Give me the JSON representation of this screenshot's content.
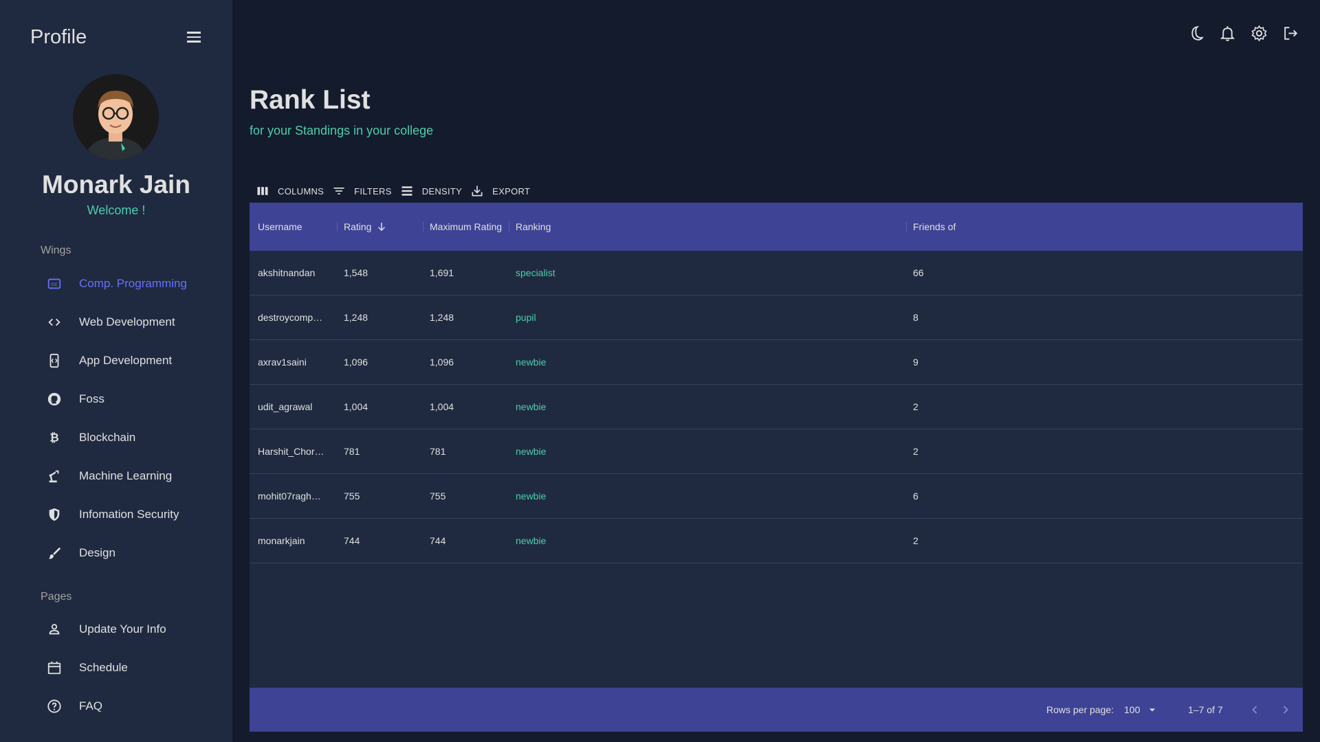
{
  "sidebar": {
    "title": "Profile",
    "user": {
      "name": "Monark Jain",
      "welcome": "Welcome !"
    },
    "sections": {
      "wings": "Wings",
      "pages": "Pages"
    },
    "wings_items": [
      {
        "label": "Comp. Programming",
        "icon": "closed-caption-icon",
        "active": true
      },
      {
        "label": "Web Development",
        "icon": "code-icon"
      },
      {
        "label": "App Development",
        "icon": "mobile-code-icon"
      },
      {
        "label": "Foss",
        "icon": "github-icon"
      },
      {
        "label": "Blockchain",
        "icon": "bitcoin-icon"
      },
      {
        "label": "Machine Learning",
        "icon": "robot-arm-icon"
      },
      {
        "label": "Infomation Security",
        "icon": "shield-icon"
      },
      {
        "label": "Design",
        "icon": "brush-icon"
      }
    ],
    "pages_items": [
      {
        "label": "Update Your Info",
        "icon": "person-icon"
      },
      {
        "label": "Schedule",
        "icon": "calendar-icon"
      },
      {
        "label": "FAQ",
        "icon": "help-circle-icon"
      }
    ]
  },
  "topbar": {
    "icons": [
      "dark-mode-icon",
      "notifications-icon",
      "settings-icon",
      "logout-icon"
    ]
  },
  "page": {
    "title": "Rank List",
    "subtitle": "for your Standings in your college"
  },
  "toolbar": {
    "columns": "COLUMNS",
    "filters": "FILTERS",
    "density": "DENSITY",
    "export": "EXPORT"
  },
  "table": {
    "headers": {
      "username": "Username",
      "rating": "Rating",
      "max_rating": "Maximum Rating",
      "ranking": "Ranking",
      "friends": "Friends of"
    },
    "sort": {
      "column": "Rating",
      "direction": "descending"
    },
    "rows": [
      {
        "username": "akshitnandan",
        "rating": "1,548",
        "max_rating": "1,691",
        "ranking": "specialist",
        "friends": "66"
      },
      {
        "username": "destroycomp…",
        "rating": "1,248",
        "max_rating": "1,248",
        "ranking": "pupil",
        "friends": "8"
      },
      {
        "username": "axrav1saini",
        "rating": "1,096",
        "max_rating": "1,096",
        "ranking": "newbie",
        "friends": "9"
      },
      {
        "username": "udit_agrawal",
        "rating": "1,004",
        "max_rating": "1,004",
        "ranking": "newbie",
        "friends": "2"
      },
      {
        "username": "Harshit_Chor…",
        "rating": "781",
        "max_rating": "781",
        "ranking": "newbie",
        "friends": "2"
      },
      {
        "username": "mohit07ragh…",
        "rating": "755",
        "max_rating": "755",
        "ranking": "newbie",
        "friends": "6"
      },
      {
        "username": "monarkjain",
        "rating": "744",
        "max_rating": "744",
        "ranking": "newbie",
        "friends": "2"
      }
    ]
  },
  "footer": {
    "rows_per_page_label": "Rows per page:",
    "rows_per_page_value": "100",
    "range": "1–7 of 7"
  },
  "colors": {
    "background": "#141b2d",
    "panel": "#1f2a40",
    "header": "#3e4396",
    "accent_green": "#4cceac",
    "accent_blue": "#6870fa"
  }
}
